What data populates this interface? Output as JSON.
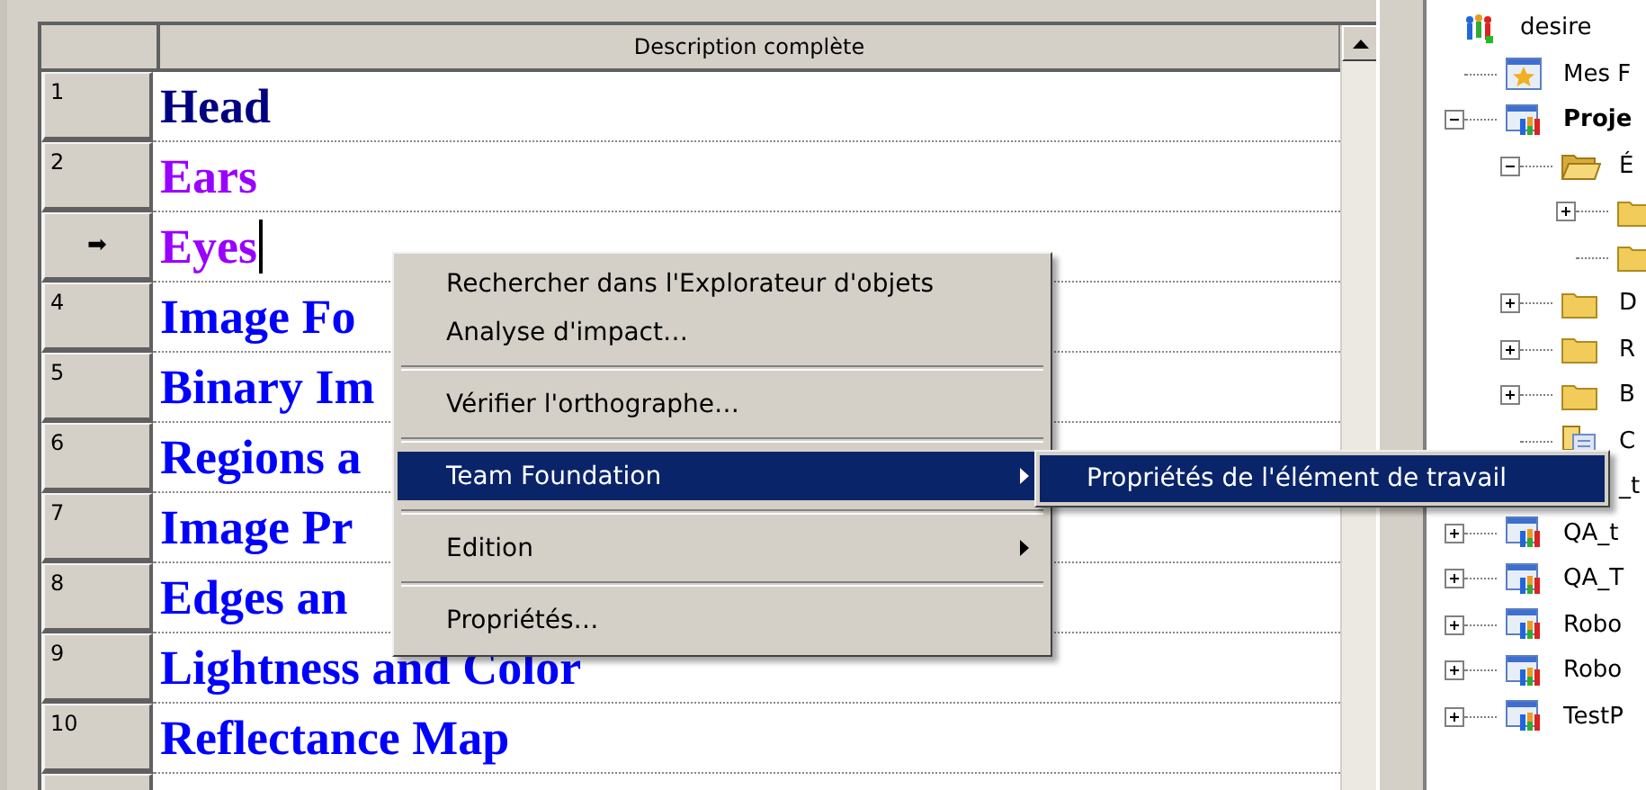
{
  "grid": {
    "column_header": "Description complète",
    "rows": [
      {
        "header": "1",
        "text": "Head",
        "color": "#000080",
        "editing": false
      },
      {
        "header": "2",
        "text": "Ears",
        "color": "#9900ff",
        "editing": false
      },
      {
        "header": "➡",
        "text": "Eyes",
        "color": "#9900ff",
        "editing": true
      },
      {
        "header": "4",
        "text": "Image Fo",
        "color": "#0000ff",
        "editing": false
      },
      {
        "header": "5",
        "text": "Binary Im",
        "color": "#0000ff",
        "editing": false
      },
      {
        "header": "6",
        "text": "Regions a",
        "color": "#0000ff",
        "editing": false
      },
      {
        "header": "7",
        "text": "Image Pr",
        "color": "#0000ff",
        "editing": false
      },
      {
        "header": "8",
        "text": "Edges an",
        "color": "#0000ff",
        "editing": false
      },
      {
        "header": "9",
        "text": "Lightness and Color",
        "color": "#0000ff",
        "editing": false
      },
      {
        "header": "10",
        "text": "Reflectance Map",
        "color": "#0000ff",
        "editing": false
      }
    ]
  },
  "context_menu": {
    "items": [
      {
        "kind": "item",
        "label": "Rechercher dans l'Explorateur d'objets",
        "selected": false,
        "submenu": false
      },
      {
        "kind": "item",
        "label": "Analyse d'impact…",
        "selected": false,
        "submenu": false
      },
      {
        "kind": "separator"
      },
      {
        "kind": "item",
        "label": "Vérifier l'orthographe…",
        "selected": false,
        "submenu": false
      },
      {
        "kind": "separator"
      },
      {
        "kind": "item",
        "label": "Team Foundation",
        "selected": true,
        "submenu": true
      },
      {
        "kind": "separator"
      },
      {
        "kind": "item",
        "label": "Edition",
        "selected": false,
        "submenu": true
      },
      {
        "kind": "separator"
      },
      {
        "kind": "item",
        "label": "Propriétés…",
        "selected": false,
        "submenu": false
      }
    ]
  },
  "submenu": {
    "items": [
      {
        "label": "Propriétés de l'élément de travail",
        "selected": true
      }
    ]
  },
  "tree": {
    "items": [
      {
        "label": "desire",
        "kind": "team",
        "children": [
          {
            "label": "Mes F",
            "kind": "favorites"
          },
          {
            "label": "Proje",
            "kind": "project",
            "bold": true,
            "expanded": true,
            "children": [
              {
                "label": "É",
                "kind": "folder-open",
                "expanded": true,
                "children": [
                  {
                    "kind": "folder",
                    "expanded": false
                  },
                  {
                    "kind": "folder"
                  }
                ]
              },
              {
                "label": "D",
                "kind": "folder",
                "expanded": false
              },
              {
                "label": "R",
                "kind": "folder",
                "expanded": false
              },
              {
                "label": "B",
                "kind": "folder",
                "expanded": false
              },
              {
                "label": "C",
                "kind": "document"
              },
              {
                "label": "_t"
              }
            ]
          },
          {
            "label": "QA_t",
            "kind": "project",
            "expanded": false
          },
          {
            "label": "QA_T",
            "kind": "project",
            "expanded": false
          },
          {
            "label": "Robo",
            "kind": "project",
            "expanded": false
          },
          {
            "label": "Robo",
            "kind": "project",
            "expanded": false
          },
          {
            "label": "TestP",
            "kind": "project",
            "expanded": false
          }
        ]
      }
    ]
  }
}
